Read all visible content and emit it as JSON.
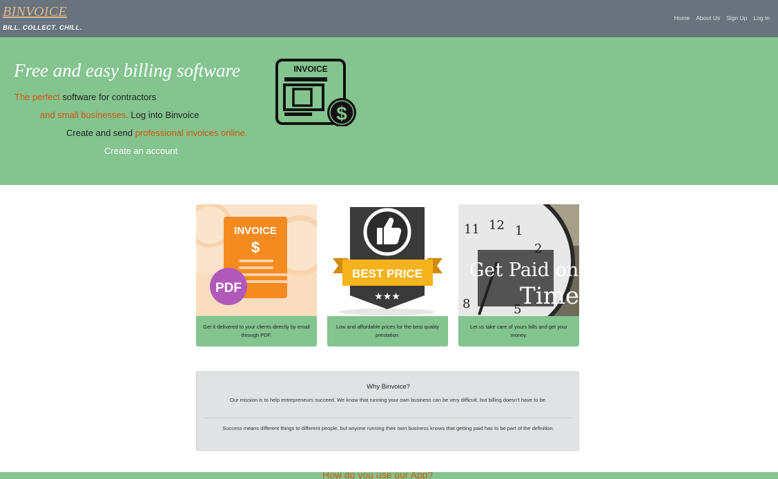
{
  "header": {
    "brand": "BINVOICE",
    "tagline": "BILL. COLLECT. CHILL.",
    "nav": [
      "Home",
      "About Us",
      "Sign Up",
      "Log In"
    ]
  },
  "hero": {
    "title": "Free and easy billing software",
    "line1": {
      "hl": "The perfect",
      "rest": " software for contractors"
    },
    "line2": {
      "hl": "and small businesses.",
      "rest": " Log into Binvoice"
    },
    "line3": {
      "rest": "Create and send ",
      "hl": "professional invoices online."
    },
    "cta": "Create an account",
    "icon_label": "INVOICE"
  },
  "cards": [
    {
      "image_text": "INVOICE",
      "badge": "PDF",
      "caption": "Get it delivered to your clients directly by email through PDF."
    },
    {
      "image_text": "BEST PRICE",
      "caption": "Low and affordable prices for the best quality prestation."
    },
    {
      "image_text_1": "Get Paid on",
      "image_text_2": "Time",
      "caption": "Let us take care of yours bills and get your money."
    }
  ],
  "why": {
    "title": "Why Binvoice?",
    "p1": "Our mission is to help entrepreneurs succeed. We know that running your own business can be very difficult, but billing doesn't have to be.",
    "p2": "Success means different things to different people, but anyone running their own business knows that getting paid has to be part of the definition."
  },
  "bottom": {
    "title": "How do you use our App?"
  },
  "colors": {
    "hero_green": "#83c48f",
    "accent_orange": "#d4540d",
    "nav_gray": "#68737d",
    "brand_tan": "#e0b68d"
  }
}
